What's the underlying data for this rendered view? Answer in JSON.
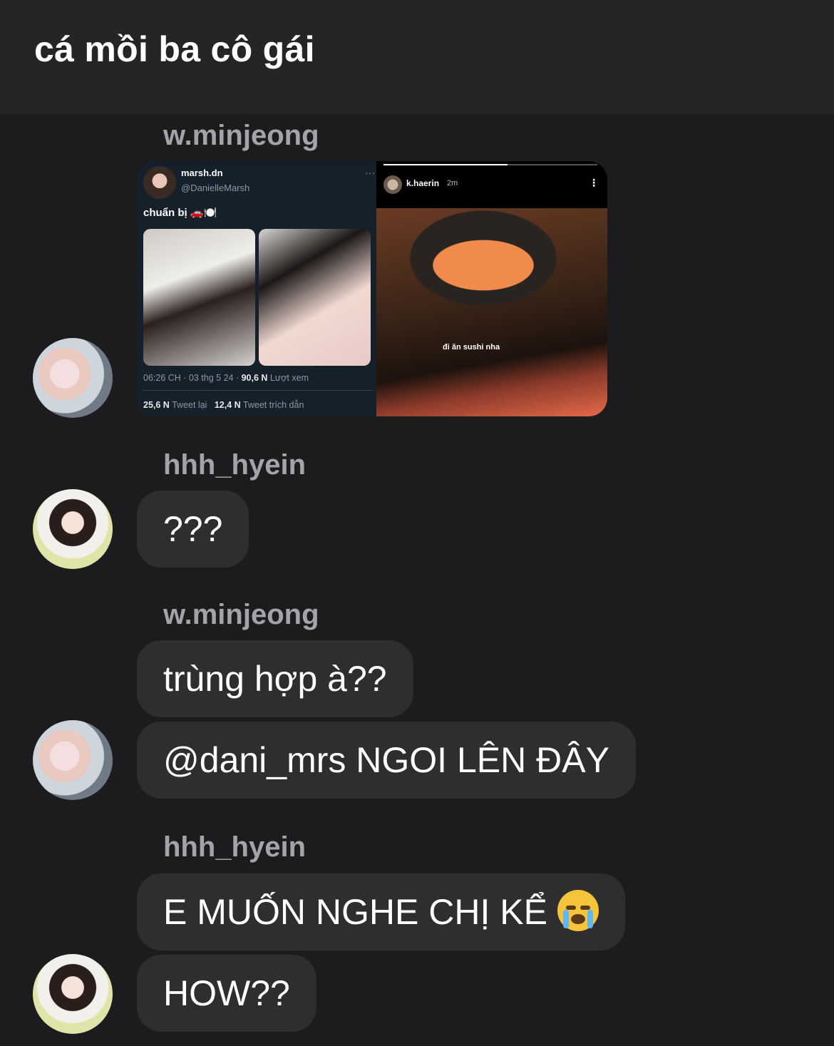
{
  "header": {
    "title": "cá mồi ba cô gái"
  },
  "shared_media": {
    "tweet": {
      "name": "marsh.dn",
      "handle": "@DanielleMarsh",
      "more": "···",
      "text": "chuẩn bị 🚗🍽️",
      "time": "06:26 CH · 03 thg 5 24 · ",
      "views_value": "90,6 N",
      "views_label": " Lượt xem",
      "retweets_value": "25,6 N",
      "retweets_label": " Tweet lại",
      "quotes_value": "12,4 N",
      "quotes_label": " Tweet trích dẫn"
    },
    "story": {
      "username": "k.haerin",
      "time": "2m",
      "menu": "⋮",
      "caption": "đi ăn sushi nha"
    }
  },
  "messages": [
    {
      "sender": "w.minjeong"
    },
    {
      "sender": "hhh_hyein",
      "text": "???"
    },
    {
      "sender": "w.minjeong",
      "text1": "trùng hợp à??",
      "text2": "@dani_mrs NGOI LÊN ĐÂY"
    },
    {
      "sender": "hhh_hyein",
      "text1": "E MUỐN NGHE CHỊ KỂ ",
      "text2": "HOW??"
    }
  ],
  "emoji": "loudly-crying-face"
}
